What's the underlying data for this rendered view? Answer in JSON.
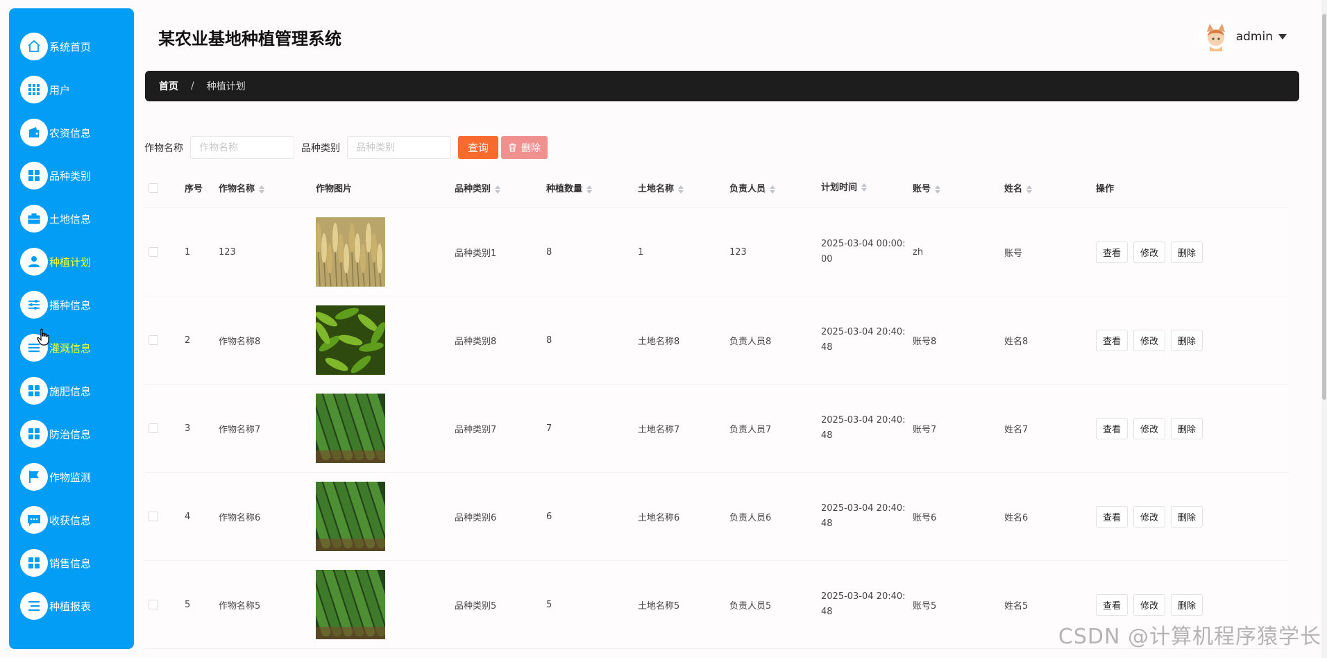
{
  "app": {
    "title": "某农业基地种植管理系统"
  },
  "user": {
    "name": "admin"
  },
  "sidebar": {
    "items": [
      {
        "label": "系统首页",
        "icon": "home-icon"
      },
      {
        "label": "用户",
        "icon": "grid-icon"
      },
      {
        "label": "农资信息",
        "icon": "wallet-icon"
      },
      {
        "label": "品种类别",
        "icon": "apps-icon"
      },
      {
        "label": "土地信息",
        "icon": "briefcase-icon"
      },
      {
        "label": "种植计划",
        "icon": "person-icon",
        "active": true
      },
      {
        "label": "播种信息",
        "icon": "sliders-icon"
      },
      {
        "label": "灌溉信息",
        "icon": "menu-icon",
        "hover": true
      },
      {
        "label": "施肥信息",
        "icon": "apps-icon"
      },
      {
        "label": "防治信息",
        "icon": "apps-icon"
      },
      {
        "label": "作物监测",
        "icon": "flag-icon"
      },
      {
        "label": "收获信息",
        "icon": "chat-icon"
      },
      {
        "label": "销售信息",
        "icon": "apps-icon"
      },
      {
        "label": "种植报表",
        "icon": "list-icon"
      }
    ]
  },
  "breadcrumb": {
    "home": "首页",
    "separator": "/",
    "current": "种植计划"
  },
  "search": {
    "name_label": "作物名称",
    "name_placeholder": "作物名称",
    "type_label": "品种类别",
    "type_placeholder": "品种类别",
    "query_label": "查询",
    "delete_label": "删除"
  },
  "table": {
    "headers": {
      "idx": "序号",
      "name": "作物名称",
      "img": "作物图片",
      "type": "品种类别",
      "qty": "种植数量",
      "land": "土地名称",
      "owner": "负责人员",
      "time": "计划时间",
      "acct": "账号",
      "uname": "姓名",
      "ops": "操作"
    },
    "rows": [
      {
        "idx": "1",
        "name": "123",
        "img": "wheat",
        "type": "品种类别1",
        "qty": "8",
        "land": "1",
        "owner": "123",
        "time": "2025-03-04 00:00:00",
        "acct": "zh",
        "uname": "账号"
      },
      {
        "idx": "2",
        "name": "作物名称8",
        "img": "pepper",
        "type": "品种类别8",
        "qty": "8",
        "land": "土地名称8",
        "owner": "负责人员8",
        "time": "2025-03-04 20:40:48",
        "acct": "账号8",
        "uname": "姓名8"
      },
      {
        "idx": "3",
        "name": "作物名称7",
        "img": "cucumber",
        "type": "品种类别7",
        "qty": "7",
        "land": "土地名称7",
        "owner": "负责人员7",
        "time": "2025-03-04 20:40:48",
        "acct": "账号7",
        "uname": "姓名7"
      },
      {
        "idx": "4",
        "name": "作物名称6",
        "img": "cucumber",
        "type": "品种类别6",
        "qty": "6",
        "land": "土地名称6",
        "owner": "负责人员6",
        "time": "2025-03-04 20:40:48",
        "acct": "账号6",
        "uname": "姓名6"
      },
      {
        "idx": "5",
        "name": "作物名称5",
        "img": "cucumber",
        "type": "品种类别5",
        "qty": "5",
        "land": "土地名称5",
        "owner": "负责人员5",
        "time": "2025-03-04 20:40:48",
        "acct": "账号5",
        "uname": "姓名5"
      }
    ],
    "actions": {
      "view": "查看",
      "edit": "修改",
      "delete": "删除"
    }
  },
  "watermark": "CSDN @计算机程序猿学长",
  "colors": {
    "sidebar": "#049df6",
    "active_text": "#f5ff2b",
    "query_button": "#f86b2f",
    "delete_button": "#f09190",
    "breadcrumb_bg": "#1d1d1d"
  }
}
